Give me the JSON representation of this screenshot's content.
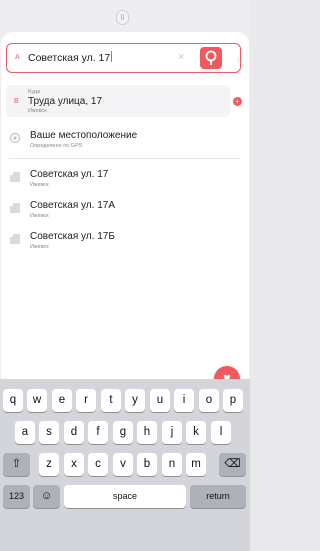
{
  "route": {
    "from": {
      "letter": "A",
      "value": "Советская ул. 17"
    },
    "to": {
      "letter": "B",
      "label": "Куда",
      "value": "Труда улица, 17",
      "city": "Ижевск"
    }
  },
  "icons": {
    "clear": "×",
    "swap": "↑↓",
    "add": "+",
    "favorite": "♥",
    "shift": "⇧",
    "backspace": "⌫",
    "emoji": "☺"
  },
  "suggestions": [
    {
      "icon": "gps-target-icon",
      "title": "Ваше местоположение",
      "subtitle": "Определено по GPS"
    },
    {
      "icon": "building-icon",
      "title": "Советская ул. 17",
      "subtitle": "Ижевск"
    },
    {
      "icon": "building-icon",
      "title": "Советская ул. 17А",
      "subtitle": "Ижевск"
    },
    {
      "icon": "building-icon",
      "title": "Советская ул. 17Б",
      "subtitle": "Ижевск"
    }
  ],
  "keyboard": {
    "row1": [
      "q",
      "w",
      "e",
      "r",
      "t",
      "y",
      "u",
      "i",
      "o",
      "p"
    ],
    "row2": [
      "a",
      "s",
      "d",
      "f",
      "g",
      "h",
      "j",
      "k",
      "l"
    ],
    "row3": [
      "z",
      "x",
      "c",
      "v",
      "b",
      "n",
      "m"
    ],
    "numbers_key": "123",
    "space_key": "space",
    "return_key": "return"
  },
  "colors": {
    "accent": "#f05a5e",
    "keyboard_bg": "#d3d5da"
  }
}
